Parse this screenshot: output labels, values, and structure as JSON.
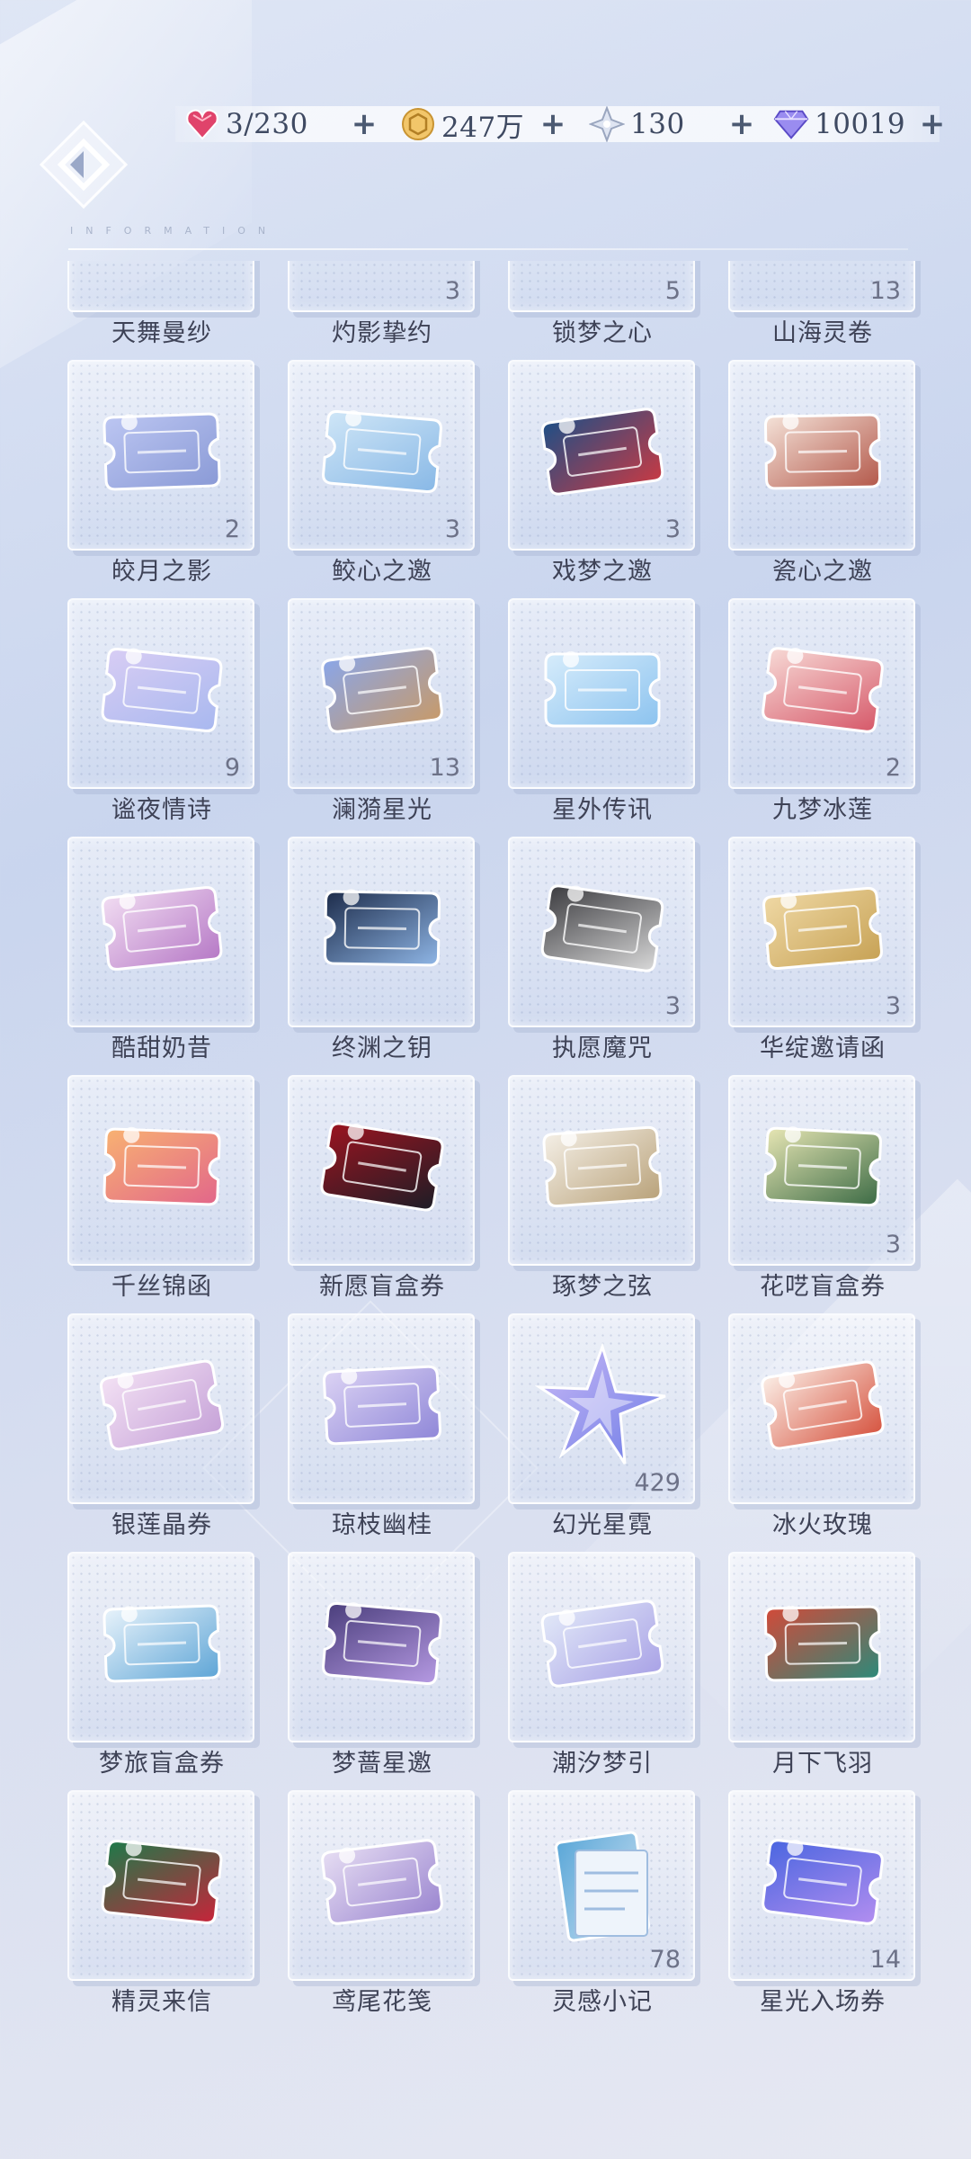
{
  "resources": [
    {
      "icon": "heart-gem-icon",
      "value": "3/230",
      "color": "#e0436b"
    },
    {
      "icon": "gold-coin-icon",
      "value": "247万",
      "color": "#e3b04d"
    },
    {
      "icon": "crystal-star-icon",
      "value": "130",
      "color": "#b8c2d8"
    },
    {
      "icon": "diamond-icon",
      "value": "10019",
      "color": "#7d6ee0"
    }
  ],
  "plus": "+",
  "header": {
    "label": "INFORMATION"
  },
  "items": [
    {
      "name": "天舞曼纱",
      "count": "",
      "icon": "ticket-icon",
      "c1": "#d9c7f2",
      "c2": "#7e92d6"
    },
    {
      "name": "灼影挚约",
      "count": "3",
      "icon": "ticket-icon",
      "c1": "#2d3a66",
      "c2": "#9aa8d8"
    },
    {
      "name": "锁梦之心",
      "count": "5",
      "icon": "ticket-icon",
      "c1": "#2da0c8",
      "c2": "#1b4d8a"
    },
    {
      "name": "山海灵卷",
      "count": "13",
      "icon": "ticket-icon",
      "c1": "#cfe9d8",
      "c2": "#9cc7b6"
    },
    {
      "name": "皎月之影",
      "count": "2",
      "icon": "ticket-icon",
      "c1": "#bcc6f2",
      "c2": "#8a9ad6"
    },
    {
      "name": "鲛心之邀",
      "count": "3",
      "icon": "ticket-icon",
      "c1": "#cfe6f7",
      "c2": "#88b8e6"
    },
    {
      "name": "戏梦之邀",
      "count": "3",
      "icon": "ticket-icon",
      "c1": "#1f4f86",
      "c2": "#c73a44"
    },
    {
      "name": "瓷心之邀",
      "count": "",
      "icon": "ticket-icon",
      "c1": "#f4e2d8",
      "c2": "#b3584a"
    },
    {
      "name": "谧夜情诗",
      "count": "9",
      "icon": "ticket-icon",
      "c1": "#d8cdf4",
      "c2": "#a8b8ef"
    },
    {
      "name": "澜漪星光",
      "count": "13",
      "icon": "ticket-icon",
      "c1": "#8aa6e8",
      "c2": "#c79a6a"
    },
    {
      "name": "星外传讯",
      "count": "",
      "icon": "ticket-icon",
      "c1": "#d6ecfb",
      "c2": "#8cc3ef"
    },
    {
      "name": "九梦冰莲",
      "count": "2",
      "icon": "ticket-icon",
      "c1": "#f7dad6",
      "c2": "#d65869"
    },
    {
      "name": "酷甜奶昔",
      "count": "",
      "icon": "ticket-icon",
      "c1": "#f1dcf2",
      "c2": "#b679c6"
    },
    {
      "name": "终渊之钥",
      "count": "",
      "icon": "ticket-icon",
      "c1": "#1c2b4a",
      "c2": "#8fb6e6"
    },
    {
      "name": "执愿魔咒",
      "count": "3",
      "icon": "ticket-icon",
      "c1": "#3b3b3f",
      "c2": "#d9d9d9"
    },
    {
      "name": "华绽邀请函",
      "count": "3",
      "icon": "ticket-icon",
      "c1": "#efd8a4",
      "c2": "#c7a255"
    },
    {
      "name": "千丝锦函",
      "count": "",
      "icon": "ticket-icon",
      "c1": "#f8b272",
      "c2": "#e2668a"
    },
    {
      "name": "新愿盲盒券",
      "count": "",
      "icon": "ticket-icon",
      "c1": "#9b1420",
      "c2": "#1d1d26"
    },
    {
      "name": "琢梦之弦",
      "count": "",
      "icon": "ticket-icon",
      "c1": "#f4efe6",
      "c2": "#b9a27a"
    },
    {
      "name": "花呓盲盒券",
      "count": "3",
      "icon": "ticket-icon",
      "c1": "#e7e6b4",
      "c2": "#3c6b45"
    },
    {
      "name": "银莲晶券",
      "count": "",
      "icon": "ticket-icon",
      "c1": "#f3e1f4",
      "c2": "#c6a2d8"
    },
    {
      "name": "琼枝幽桂",
      "count": "",
      "icon": "ticket-icon",
      "c1": "#dcd3f4",
      "c2": "#8f87d8"
    },
    {
      "name": "幻光星霓",
      "count": "429",
      "icon": "star-crystal-icon",
      "c1": "#c9b9f6",
      "c2": "#6c7be6"
    },
    {
      "name": "冰火玫瑰",
      "count": "",
      "icon": "ticket-icon",
      "c1": "#fbeee6",
      "c2": "#d65440"
    },
    {
      "name": "梦旅盲盒券",
      "count": "",
      "icon": "ticket-icon",
      "c1": "#e8f3fb",
      "c2": "#5ea5d6"
    },
    {
      "name": "梦蔷星邀",
      "count": "",
      "icon": "ticket-icon",
      "c1": "#4a3e7c",
      "c2": "#b69ae3"
    },
    {
      "name": "潮汐梦引",
      "count": "",
      "icon": "ticket-icon",
      "c1": "#e1e8f8",
      "c2": "#a9a2e6"
    },
    {
      "name": "月下飞羽",
      "count": "",
      "icon": "ticket-icon",
      "c1": "#d24a39",
      "c2": "#2c8a7a"
    },
    {
      "name": "精灵来信",
      "count": "",
      "icon": "ticket-icon",
      "c1": "#1d7a4a",
      "c2": "#c8243a"
    },
    {
      "name": "鸢尾花笺",
      "count": "",
      "icon": "ticket-icon",
      "c1": "#e6ddf3",
      "c2": "#9b86d0"
    },
    {
      "name": "灵感小记",
      "count": "78",
      "icon": "notebook-icon",
      "c1": "#5aa7d8",
      "c2": "#cfe2f2"
    },
    {
      "name": "星光入场券",
      "count": "14",
      "icon": "ticket-icon",
      "c1": "#4a66e0",
      "c2": "#b38ef0"
    }
  ]
}
